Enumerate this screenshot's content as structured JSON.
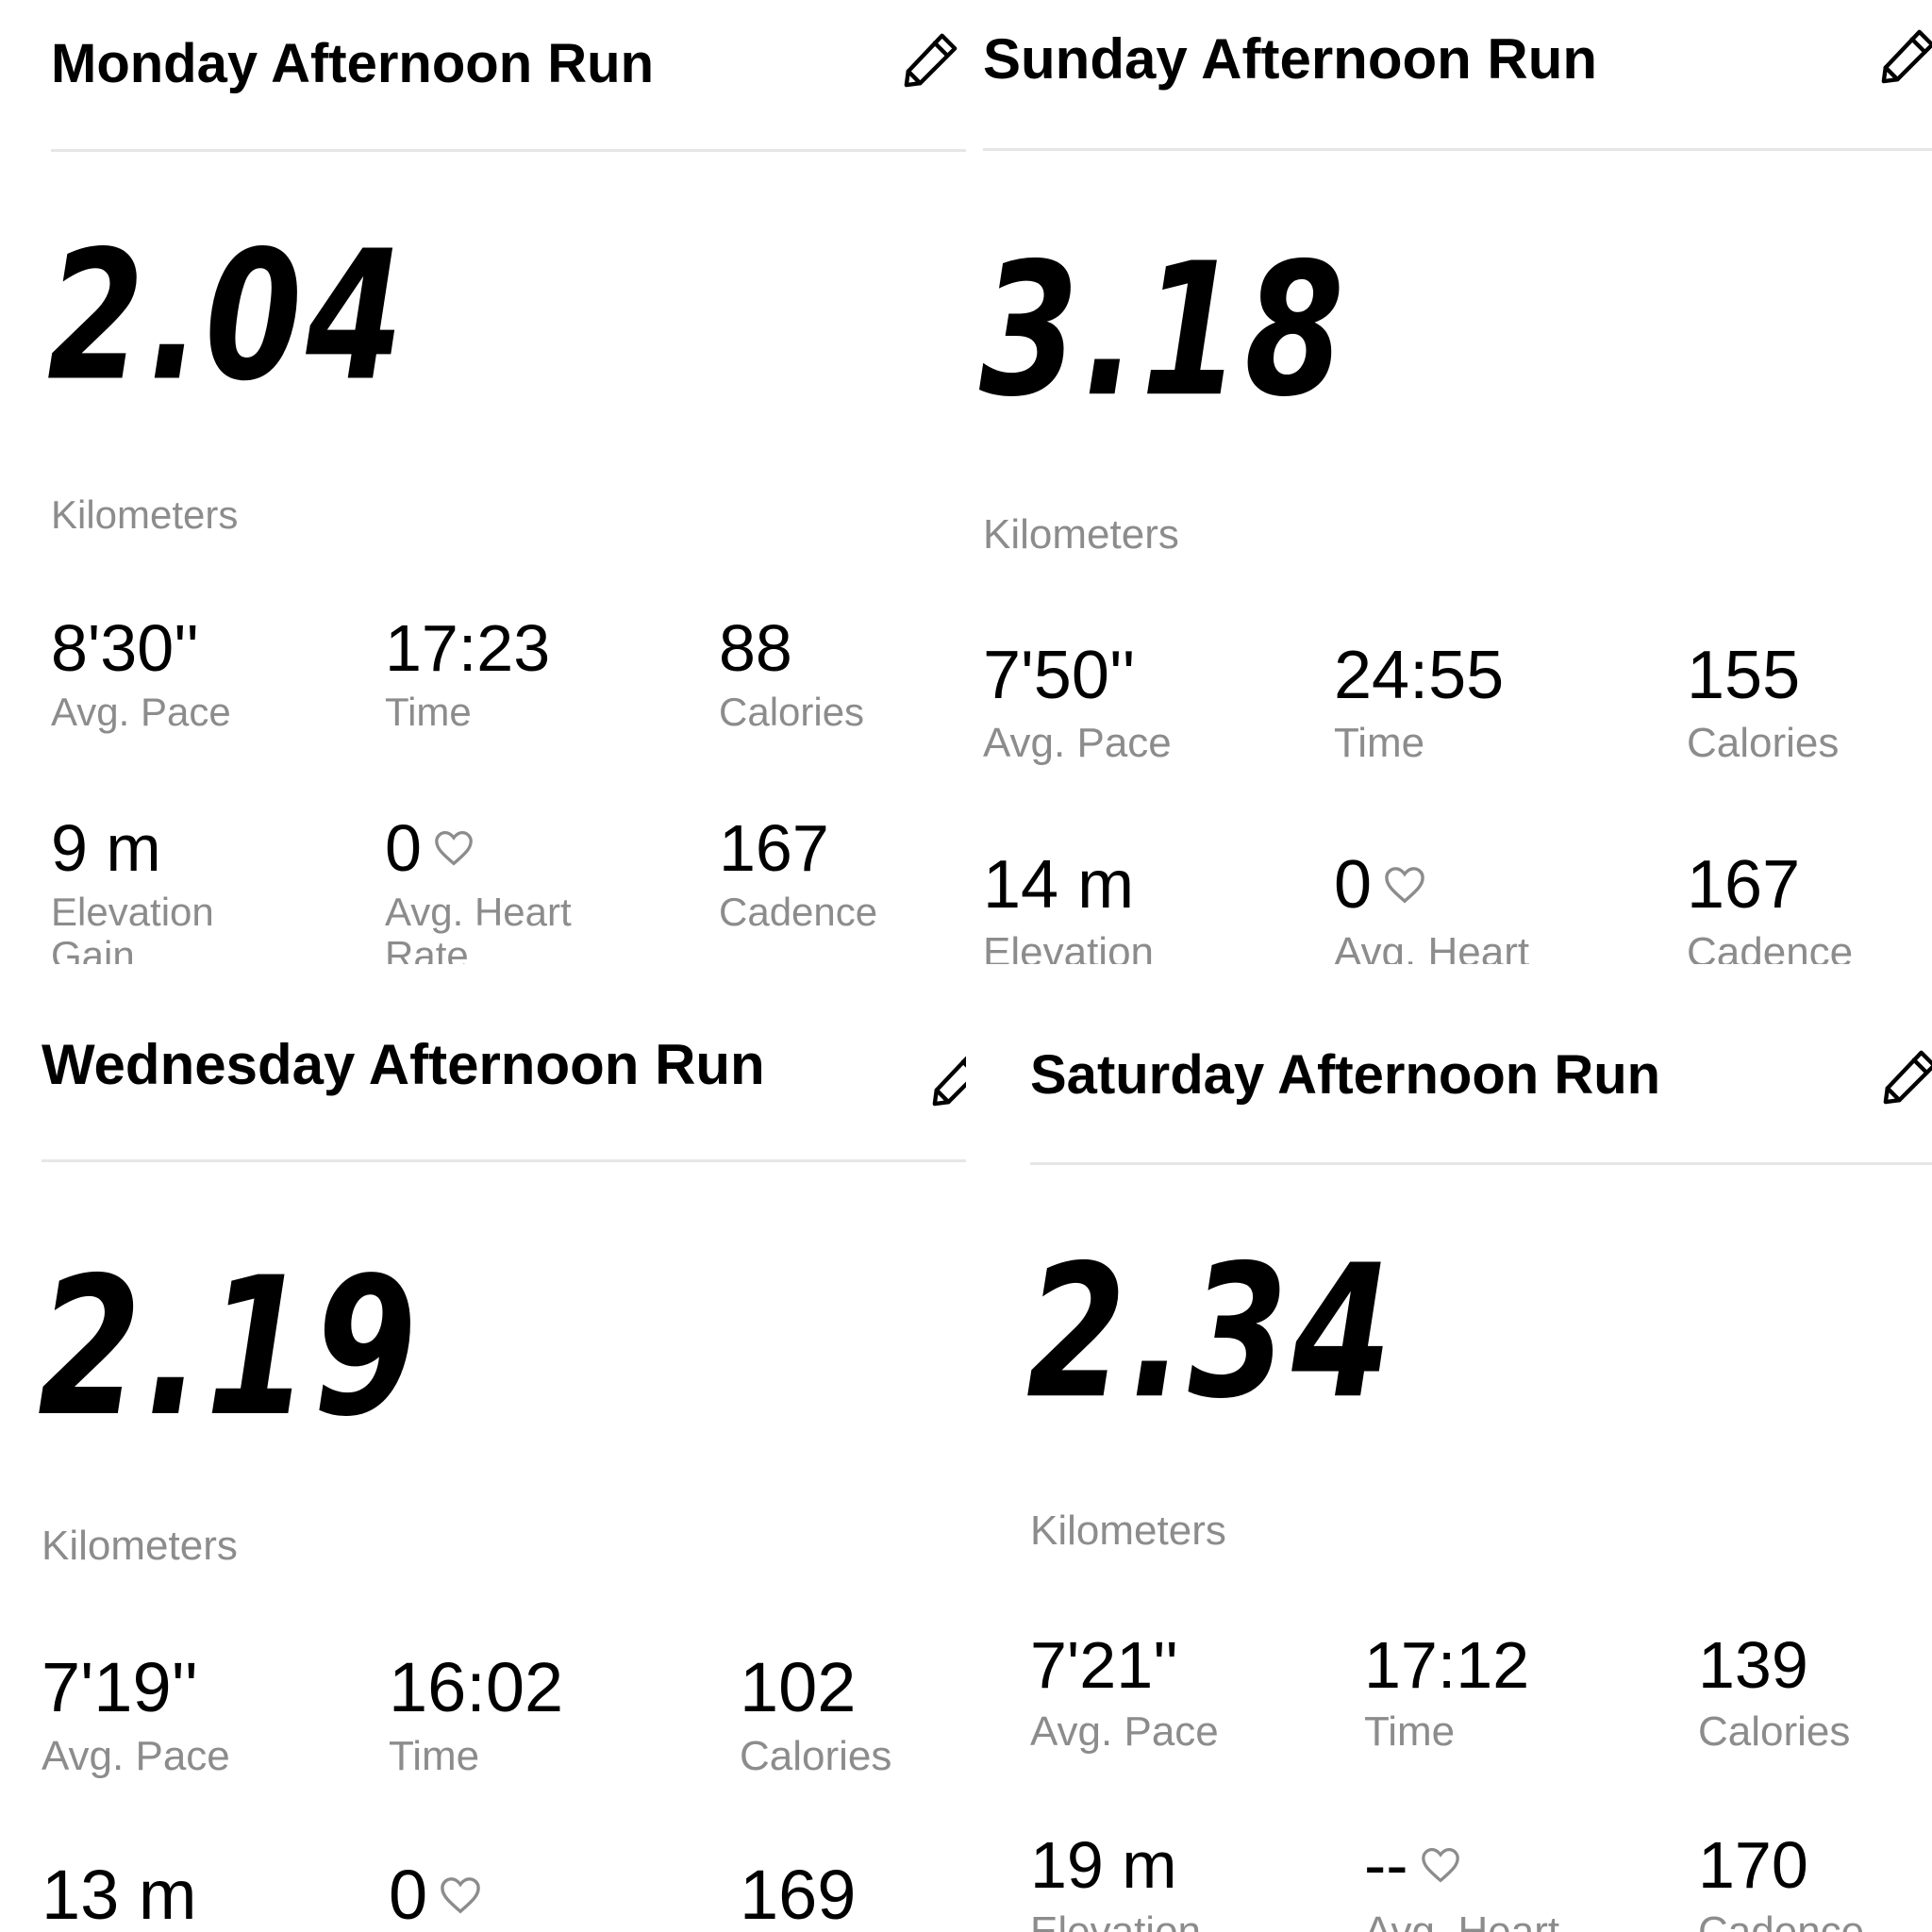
{
  "runs": [
    {
      "title": "Monday Afternoon Run",
      "distance": "2.04",
      "unit": "Kilometers",
      "pace": "8'30''",
      "pace_label": "Avg. Pace",
      "time": "17:23",
      "time_label": "Time",
      "calories": "88",
      "calories_label": "Calories",
      "elevation": "9 m",
      "elevation_label": "Elevation Gain",
      "heart_rate": "0",
      "heart_rate_label": "Avg. Heart Rate",
      "cadence": "167",
      "cadence_label": "Cadence"
    },
    {
      "title": "Sunday Afternoon Run",
      "distance": "3.18",
      "unit": "Kilometers",
      "pace": "7'50''",
      "pace_label": "Avg. Pace",
      "time": "24:55",
      "time_label": "Time",
      "calories": "155",
      "calories_label": "Calories",
      "elevation": "14 m",
      "elevation_label": "Elevation",
      "heart_rate": "0",
      "heart_rate_label": "Avg. Heart",
      "cadence": "167",
      "cadence_label": "Cadence"
    },
    {
      "title": "Wednesday Afternoon Run",
      "distance": "2.19",
      "unit": "Kilometers",
      "pace": "7'19''",
      "pace_label": "Avg. Pace",
      "time": "16:02",
      "time_label": "Time",
      "calories": "102",
      "calories_label": "Calories",
      "elevation": "13 m",
      "heart_rate": "0",
      "cadence": "169"
    },
    {
      "title": "Saturday Afternoon Run",
      "distance": "2.34",
      "unit": "Kilometers",
      "pace": "7'21''",
      "pace_label": "Avg. Pace",
      "time": "17:12",
      "time_label": "Time",
      "calories": "139",
      "calories_label": "Calories",
      "elevation": "19 m",
      "elevation_label": "Elevation",
      "heart_rate": "--",
      "heart_rate_label": "Avg. Heart",
      "cadence": "170",
      "cadence_label": "Cadence"
    }
  ],
  "icons": {
    "edit": "pencil-icon",
    "heart": "heart-outline-icon"
  },
  "colors": {
    "text": "#000000",
    "label": "#8c8c8c",
    "divider": "#e6e6e6",
    "background": "#ffffff"
  }
}
